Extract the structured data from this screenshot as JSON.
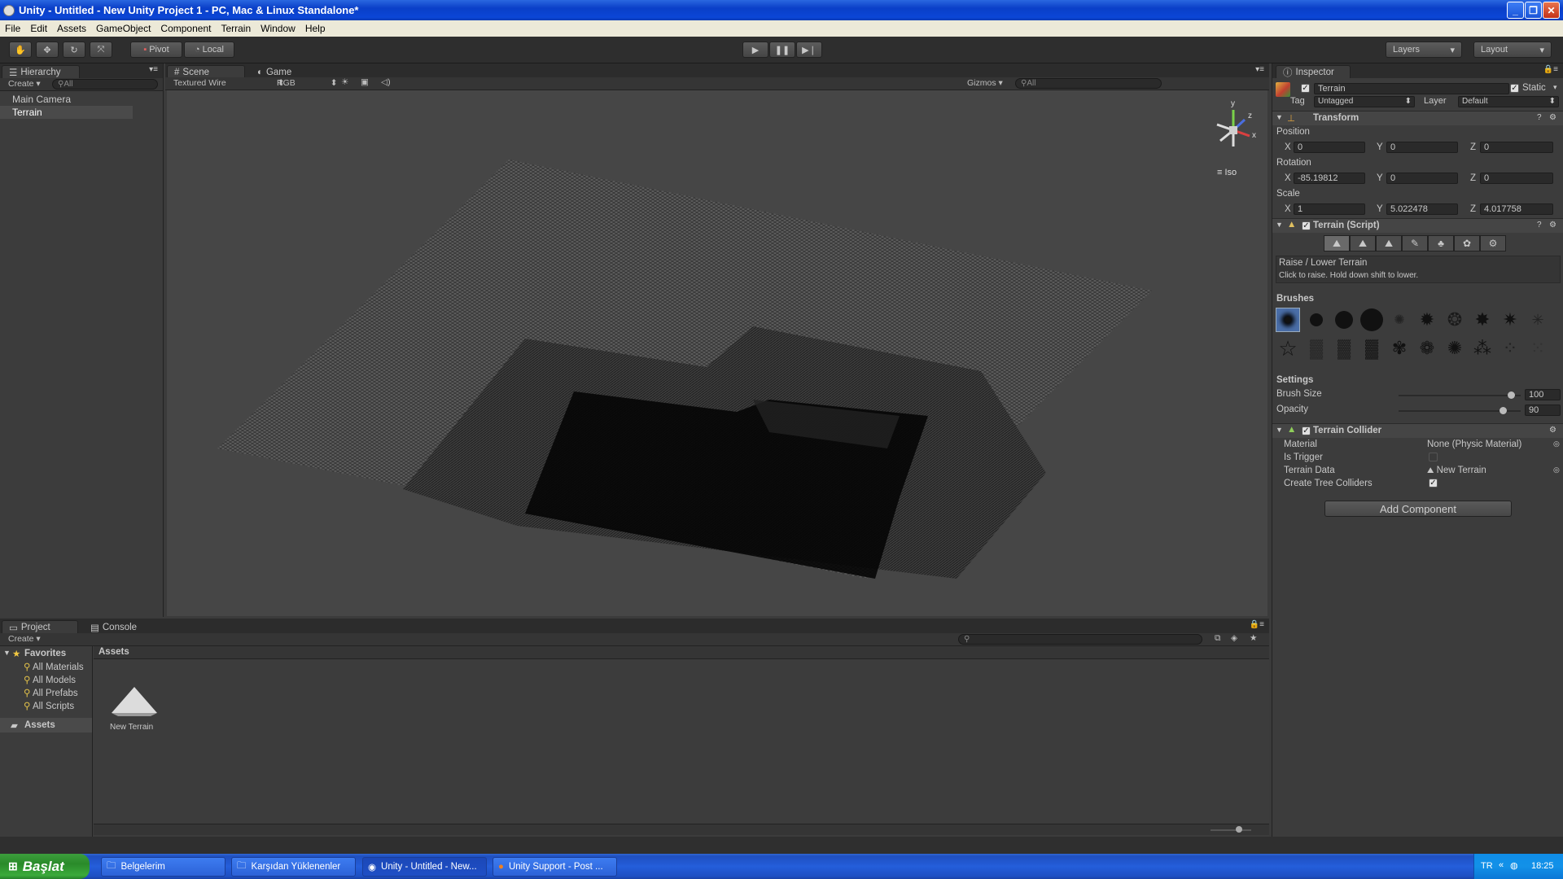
{
  "window": {
    "title": "Unity - Untitled - New Unity Project 1 - PC, Mac & Linux Standalone*"
  },
  "menu": [
    "File",
    "Edit",
    "Assets",
    "GameObject",
    "Component",
    "Terrain",
    "Window",
    "Help"
  ],
  "toolbar": {
    "pivot_label": "Pivot",
    "local_label": "Local",
    "layers_label": "Layers",
    "layout_label": "Layout"
  },
  "hierarchy": {
    "tab_label": "Hierarchy",
    "create_label": "Create",
    "search_placeholder": "All",
    "items": [
      "Main Camera",
      "Terrain"
    ],
    "selected": "Terrain"
  },
  "scene": {
    "tab_scene": "Scene",
    "tab_game": "Game",
    "render_mode": "Textured Wire",
    "color_mode": "RGB",
    "gizmos_label": "Gizmos",
    "search_placeholder": "All",
    "gizmo_axes": [
      "y",
      "z",
      "x"
    ],
    "projection_label": "Iso"
  },
  "inspector": {
    "tab_label": "Inspector",
    "object_name": "Terrain",
    "static_label": "Static",
    "tag_label": "Tag",
    "tag_value": "Untagged",
    "layer_label": "Layer",
    "layer_value": "Default",
    "transform": {
      "title": "Transform",
      "position_label": "Position",
      "position": {
        "x": "0",
        "y": "0",
        "z": "0"
      },
      "rotation_label": "Rotation",
      "rotation": {
        "x": "-85.19812",
        "y": "0",
        "z": "0"
      },
      "scale_label": "Scale",
      "scale": {
        "x": "1",
        "y": "5.022478",
        "z": "4.017758"
      },
      "axis_x": "X",
      "axis_y": "Y",
      "axis_z": "Z"
    },
    "terrain_script": {
      "title": "Terrain (Script)",
      "tool_title": "Raise / Lower Terrain",
      "tool_hint": "Click to raise. Hold down shift to lower.",
      "brushes_label": "Brushes",
      "settings_label": "Settings",
      "brush_size_label": "Brush Size",
      "brush_size_value": "100",
      "opacity_label": "Opacity",
      "opacity_value": "90",
      "brush_size_fraction": 0.95,
      "opacity_fraction": 0.88
    },
    "terrain_collider": {
      "title": "Terrain Collider",
      "material_label": "Material",
      "material_value": "None (Physic Material)",
      "is_trigger_label": "Is Trigger",
      "terrain_data_label": "Terrain Data",
      "terrain_data_value": "New Terrain",
      "tree_colliders_label": "Create Tree Colliders"
    },
    "add_component_label": "Add Component"
  },
  "project": {
    "tab_project": "Project",
    "tab_console": "Console",
    "create_label": "Create",
    "favorites_label": "Favorites",
    "favorites": [
      "All Materials",
      "All Models",
      "All Prefabs",
      "All Scripts"
    ],
    "assets_label": "Assets",
    "assets_header": "Assets",
    "asset_items": [
      "New Terrain"
    ]
  },
  "taskbar": {
    "start_label": "Başlat",
    "items": [
      "Belgelerim",
      "Karşıdan Yüklenenler",
      "Unity - Untitled - New...",
      "Unity Support - Post ..."
    ],
    "language": "TR",
    "clock": "18:25"
  }
}
